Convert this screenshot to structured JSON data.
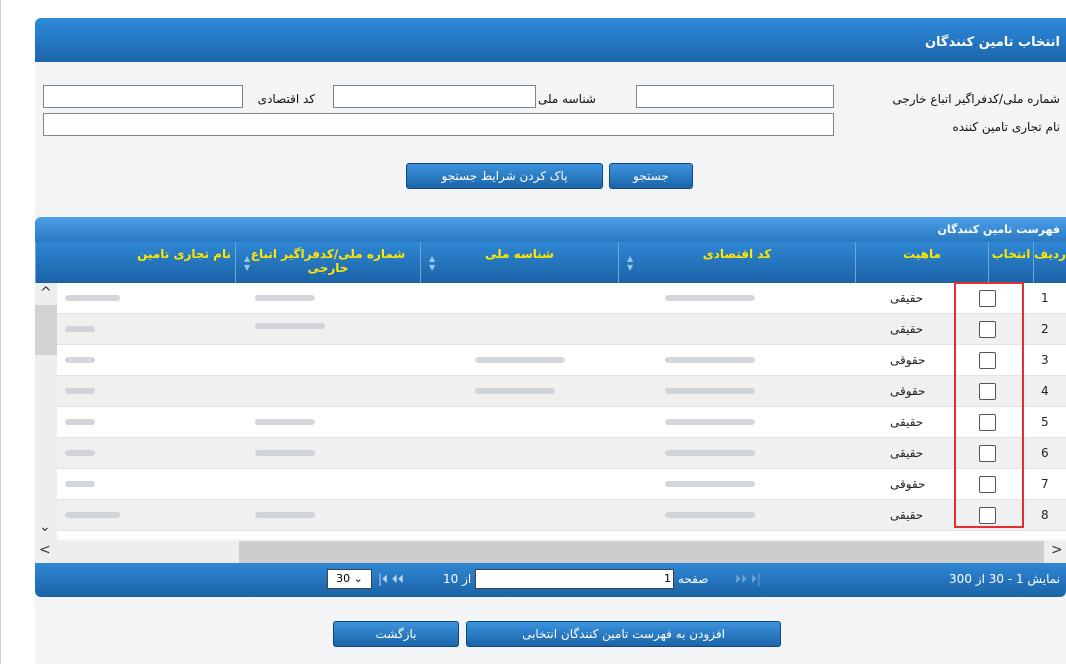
{
  "header": {
    "title": "انتخاب تامین کنندگان"
  },
  "search": {
    "national_id_label": "شماره ملی/کدفراگیر اتباع خارجی",
    "national_code_label": "شناسه ملی",
    "economic_code_label": "کد اقتصادی",
    "trade_name_label": "نام تجاری تامین کننده",
    "search_button": "جستجو",
    "clear_button": "پاک کردن شرایط جستجو"
  },
  "grid": {
    "title": "فهرست تامین کنندگان",
    "columns": [
      "ردیف",
      "انتخاب",
      "ماهیت",
      "کد اقتصادی",
      "شناسه ملی",
      "شماره ملی/کدفراگیر اتباع خارجی",
      "نام تجاری تامین"
    ],
    "rows": [
      {
        "num": "1",
        "type": "حقیقی"
      },
      {
        "num": "2",
        "type": "حقیقی"
      },
      {
        "num": "3",
        "type": "حقوقی"
      },
      {
        "num": "4",
        "type": "حقوقی"
      },
      {
        "num": "5",
        "type": "حقیقی"
      },
      {
        "num": "6",
        "type": "حقیقی"
      },
      {
        "num": "7",
        "type": "حقوقی"
      },
      {
        "num": "8",
        "type": "حقیقی"
      }
    ]
  },
  "pager": {
    "summary": "نمایش 1 - 30 از 300",
    "page_label": "صفحه",
    "page_value": "1",
    "of_label": "از 10",
    "page_size": "30"
  },
  "actions": {
    "add_button": "افزودن به فهرست تامین کنندگان انتخابی",
    "back_button": "بازگشت"
  },
  "colors": {
    "header_blue": "#1a66ad",
    "highlight_red": "#e03030",
    "header_text_yellow": "#ffe800"
  }
}
